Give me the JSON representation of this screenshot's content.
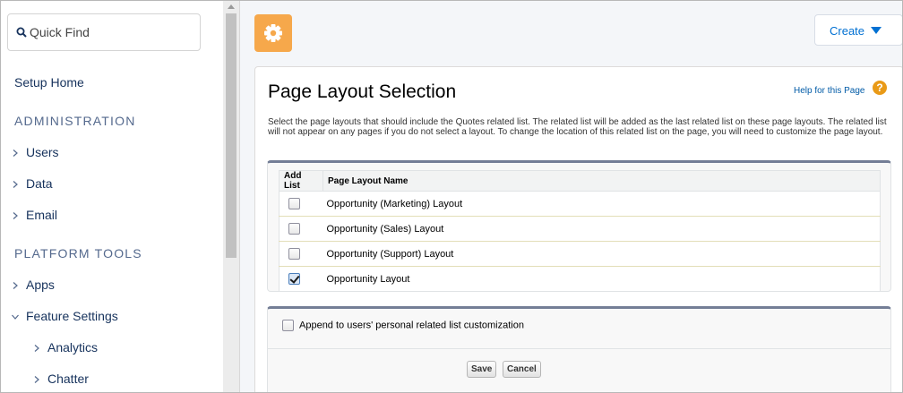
{
  "sidebar": {
    "search_placeholder": "Quick Find",
    "setup_home": "Setup Home",
    "administration_title": "ADMINISTRATION",
    "admin_items": [
      {
        "label": "Users"
      },
      {
        "label": "Data"
      },
      {
        "label": "Email"
      }
    ],
    "platform_title": "PLATFORM TOOLS",
    "platform_items": [
      {
        "label": "Apps",
        "expanded": false
      },
      {
        "label": "Feature Settings",
        "expanded": true
      }
    ],
    "feature_children": [
      {
        "label": "Analytics"
      },
      {
        "label": "Chatter"
      }
    ]
  },
  "header": {
    "create_label": "Create",
    "app_icon": "gear-icon"
  },
  "page": {
    "title": "Page Layout Selection",
    "help_link": "Help for this Page",
    "help_icon_glyph": "?",
    "description": "Select the page layouts that should include the Quotes related list. The related list will be added as the last related list on these page layouts. The related list will not appear on any pages if you do not select a layout. To change the location of this related list on the page, you will need to customize the page layout."
  },
  "table": {
    "columns": [
      "Add List",
      "Page Layout Name"
    ],
    "rows": [
      {
        "checked": false,
        "name": "Opportunity (Marketing) Layout"
      },
      {
        "checked": false,
        "name": "Opportunity (Sales) Layout"
      },
      {
        "checked": false,
        "name": "Opportunity (Support) Layout"
      },
      {
        "checked": true,
        "name": "Opportunity Layout"
      }
    ]
  },
  "append": {
    "label": "Append to users' personal related list customization",
    "checked": false
  },
  "buttons": {
    "save": "Save",
    "cancel": "Cancel"
  },
  "colors": {
    "accent": "#0070d2",
    "app_icon_bg": "#f6a84b",
    "section_border": "#747e96",
    "help_icon": "#e99a17"
  }
}
